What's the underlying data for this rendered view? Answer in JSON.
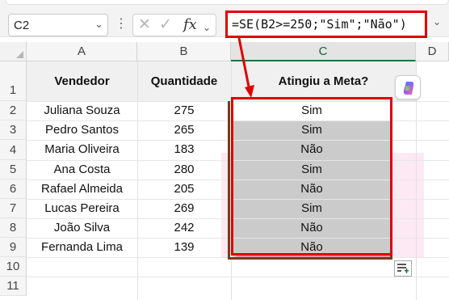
{
  "name_box": {
    "value": "C2"
  },
  "formula_bar": {
    "separator": "⋮",
    "cancel_icon": "✕",
    "enter_icon": "✓",
    "fx_label": "fx",
    "formula": "=SE(B2>=250;\"Sim\";\"Não\")"
  },
  "columns": [
    "A",
    "B",
    "C",
    "D"
  ],
  "rows": [
    "1",
    "2",
    "3",
    "4",
    "5",
    "6",
    "7",
    "8",
    "9",
    "10",
    "11"
  ],
  "table": {
    "headers": [
      "Vendedor",
      "Quantidade",
      "Atingiu a Meta?"
    ],
    "rows": [
      [
        "Juliana Souza",
        "275",
        "Sim"
      ],
      [
        "Pedro Santos",
        "265",
        "Sim"
      ],
      [
        "Maria Oliveira",
        "183",
        "Não"
      ],
      [
        "Ana Costa",
        "280",
        "Sim"
      ],
      [
        "Rafael Almeida",
        "205",
        "Não"
      ],
      [
        "Lucas Pereira",
        "269",
        "Sim"
      ],
      [
        "João Silva",
        "242",
        "Não"
      ],
      [
        "Fernanda Lima",
        "139",
        "Não"
      ]
    ]
  },
  "colors": {
    "highlight_border": "#e00000",
    "header_band": "#f0f0f0",
    "cell_fill": "#cbcbcb",
    "accent": "#217346"
  },
  "icons": {
    "copilot": "copilot-icon",
    "quick_analysis": "quick-analysis-icon",
    "name_box_dropdown": "chevron-down-icon"
  }
}
